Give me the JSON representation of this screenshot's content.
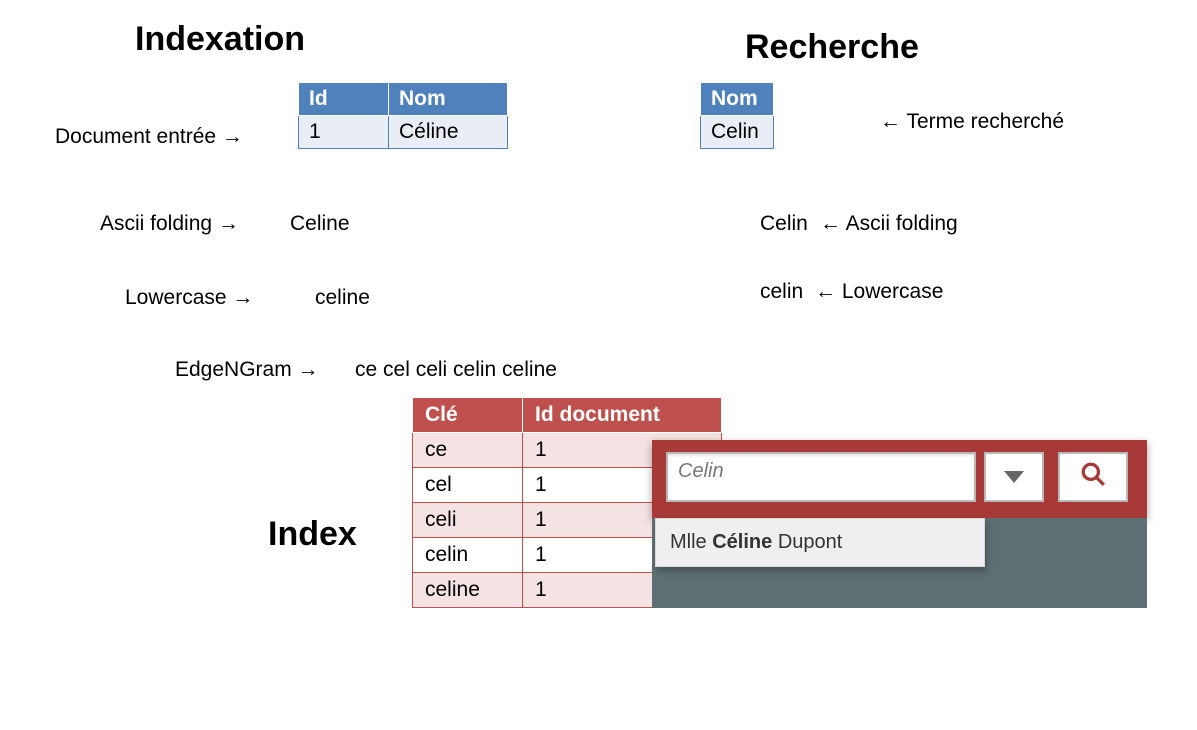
{
  "headings": {
    "indexation": "Indexation",
    "recherche": "Recherche",
    "index": "Index"
  },
  "indexation": {
    "table": {
      "headers": {
        "id": "Id",
        "nom": "Nom"
      },
      "row": {
        "id": "1",
        "nom": "Céline"
      }
    },
    "steps": {
      "doc_entry": "Document entrée →",
      "ascii": "Ascii folding →",
      "ascii_value": "Celine",
      "lowercase": "Lowercase →",
      "lowercase_value": "celine",
      "edgengram": "EdgeNGram →",
      "edgengram_value": "ce cel celi celin celine"
    }
  },
  "recherche": {
    "table": {
      "header": "Nom",
      "value": "Celin"
    },
    "steps": {
      "term": "← Terme recherché",
      "ascii_value": "Celin",
      "ascii_label": "← Ascii folding",
      "lowercase_value": "celin",
      "lowercase_label": "← Lowercase"
    }
  },
  "index_table": {
    "headers": {
      "cle": "Clé",
      "id_doc": "Id document"
    },
    "rows": [
      {
        "cle": "ce",
        "id_doc": "1"
      },
      {
        "cle": "cel",
        "id_doc": "1"
      },
      {
        "cle": "celi",
        "id_doc": "1"
      },
      {
        "cle": "celin",
        "id_doc": "1"
      },
      {
        "cle": "celine",
        "id_doc": "1"
      }
    ]
  },
  "search_ui": {
    "input_value": "Celin",
    "suggestion_prefix": "Mlle ",
    "suggestion_bold": "Céline",
    "suggestion_suffix": " Dupont"
  }
}
